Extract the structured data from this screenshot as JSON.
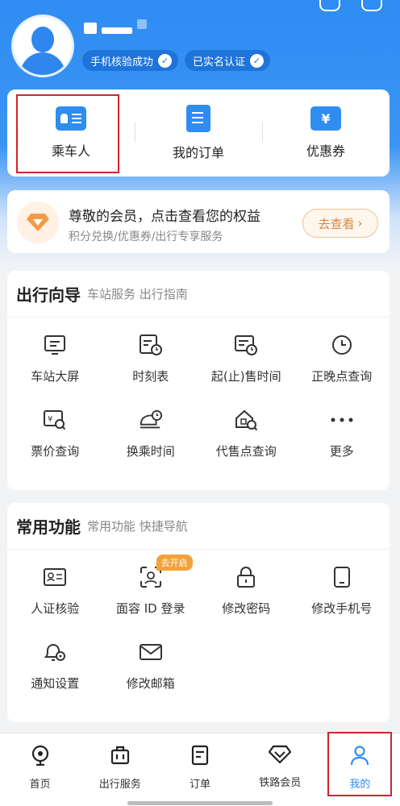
{
  "profile": {
    "badges": [
      {
        "label": "手机核验成功"
      },
      {
        "label": "已实名认证"
      }
    ]
  },
  "quick_actions": [
    {
      "label": "乘车人",
      "icon": "passenger-card-icon"
    },
    {
      "label": "我的订单",
      "icon": "order-doc-icon"
    },
    {
      "label": "优惠券",
      "icon": "coupon-icon"
    }
  ],
  "member": {
    "title": "尊敬的会员，点击查看您的权益",
    "subtitle": "积分兑换/优惠券/出行专享服务",
    "button": "去查看"
  },
  "travel_guide": {
    "title": "出行向导",
    "subtitle": "车站服务 出行指南",
    "items": [
      {
        "label": "车站大屏"
      },
      {
        "label": "时刻表"
      },
      {
        "label": "起(止)售时间"
      },
      {
        "label": "正晚点查询"
      },
      {
        "label": "票价查询"
      },
      {
        "label": "换乘时间"
      },
      {
        "label": "代售点查询"
      },
      {
        "label": "更多"
      }
    ]
  },
  "common_functions": {
    "title": "常用功能",
    "subtitle": "常用功能 快捷导航",
    "items": [
      {
        "label": "人证核验"
      },
      {
        "label": "面容 ID 登录",
        "tag": "去开启"
      },
      {
        "label": "修改密码"
      },
      {
        "label": "修改手机号"
      },
      {
        "label": "通知设置"
      },
      {
        "label": "修改邮箱"
      }
    ]
  },
  "tabbar": [
    {
      "label": "首页"
    },
    {
      "label": "出行服务"
    },
    {
      "label": "订单"
    },
    {
      "label": "铁路会员"
    },
    {
      "label": "我的",
      "active": true
    }
  ],
  "colors": {
    "primary": "#2f8df1",
    "highlight": "#d0252c",
    "accent_orange": "#f2a23b"
  }
}
